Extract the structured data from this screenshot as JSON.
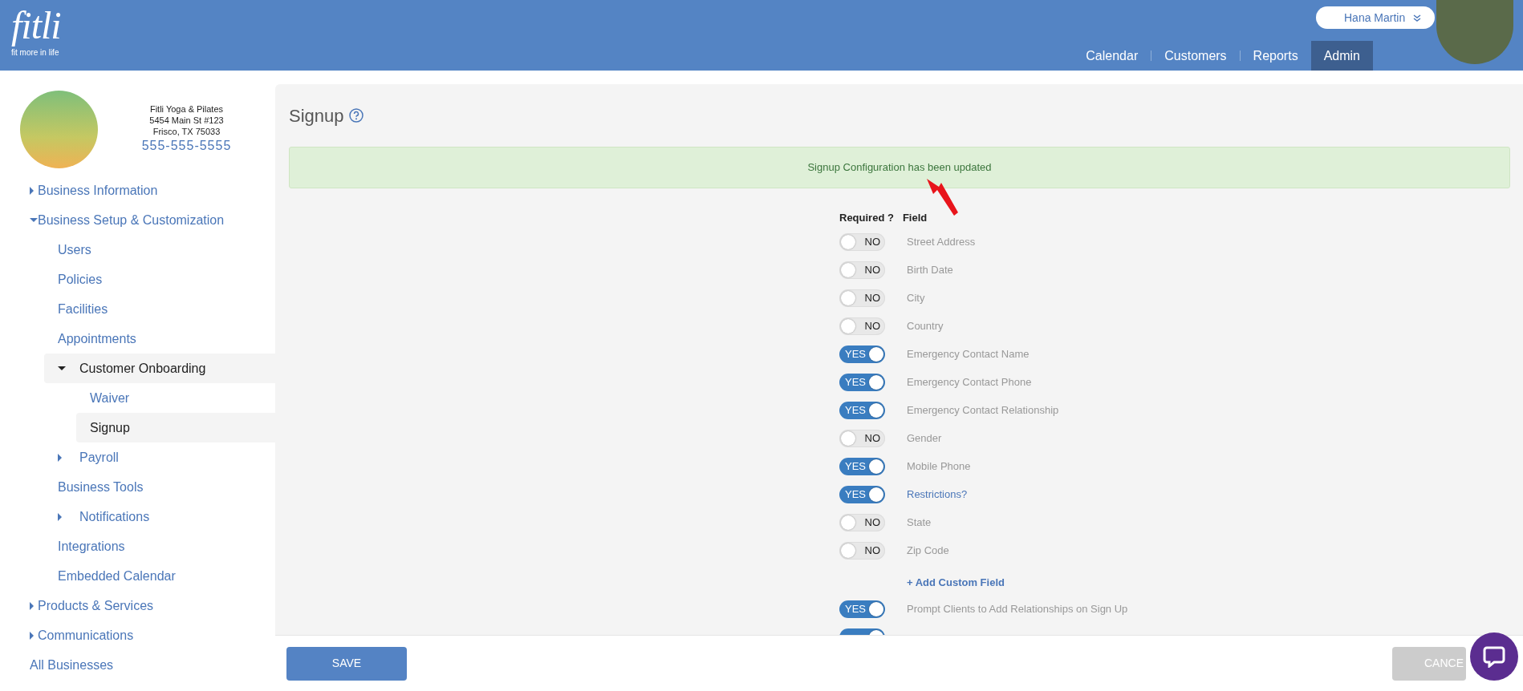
{
  "header": {
    "logo": {
      "wordmark": "fitli",
      "tagline": "fit more in life"
    },
    "user_menu": {
      "name": "Hana Martin"
    },
    "nav": [
      {
        "label": "Calendar",
        "selected": false
      },
      {
        "label": "Customers",
        "selected": false
      },
      {
        "label": "Reports",
        "selected": false
      },
      {
        "label": "Admin",
        "selected": true
      }
    ]
  },
  "business": {
    "name": "Fitli Yoga & Pilates",
    "address_line1": "5454 Main St #123",
    "address_line2": "Frisco, TX 75033",
    "phone": "555-555-5555"
  },
  "sidebar": {
    "items": [
      {
        "label": "Business Information",
        "expanded": false,
        "selected": false
      },
      {
        "label": "Business Setup & Customization",
        "expanded": true,
        "selected": false,
        "children": [
          {
            "label": "Users",
            "selected": false
          },
          {
            "label": "Policies",
            "selected": false
          },
          {
            "label": "Facilities",
            "selected": false
          },
          {
            "label": "Appointments",
            "selected": false
          },
          {
            "label": "Customer Onboarding",
            "expanded": true,
            "selected": true,
            "children": [
              {
                "label": "Waiver",
                "selected": false
              },
              {
                "label": "Signup",
                "selected": true
              }
            ]
          },
          {
            "label": "Payroll",
            "expanded": false,
            "selected": false
          },
          {
            "label": "Business Tools",
            "selected": false
          },
          {
            "label": "Notifications",
            "expanded": false,
            "selected": false
          },
          {
            "label": "Integrations",
            "selected": false
          },
          {
            "label": "Embedded Calendar",
            "selected": false
          }
        ]
      },
      {
        "label": "Products & Services",
        "expanded": false,
        "selected": false
      },
      {
        "label": "Communications",
        "expanded": false,
        "selected": false
      },
      {
        "label": "All Businesses",
        "selected": false
      }
    ]
  },
  "page": {
    "title": "Signup",
    "alert": "Signup Configuration has been updated",
    "columns": [
      "Required ?",
      "Field"
    ],
    "fields": [
      {
        "required": false,
        "toggle_text": "NO",
        "label": "Street Address",
        "kind": "text"
      },
      {
        "required": false,
        "toggle_text": "NO",
        "label": "Birth Date",
        "kind": "text"
      },
      {
        "required": false,
        "toggle_text": "NO",
        "label": "City",
        "kind": "text"
      },
      {
        "required": false,
        "toggle_text": "NO",
        "label": "Country",
        "kind": "text"
      },
      {
        "required": true,
        "toggle_text": "YES",
        "label": "Emergency Contact Name",
        "kind": "text"
      },
      {
        "required": true,
        "toggle_text": "YES",
        "label": "Emergency Contact Phone",
        "kind": "text"
      },
      {
        "required": true,
        "toggle_text": "YES",
        "label": "Emergency Contact Relationship",
        "kind": "text"
      },
      {
        "required": false,
        "toggle_text": "NO",
        "label": "Gender",
        "kind": "text"
      },
      {
        "required": true,
        "toggle_text": "YES",
        "label": "Mobile Phone",
        "kind": "text"
      },
      {
        "required": true,
        "toggle_text": "YES",
        "label": "Restrictions?",
        "kind": "link"
      },
      {
        "required": false,
        "toggle_text": "NO",
        "label": "State",
        "kind": "text"
      },
      {
        "required": false,
        "toggle_text": "NO",
        "label": "Zip Code",
        "kind": "text"
      }
    ],
    "add_link": "+ Add Custom Field",
    "extra_fields": [
      {
        "required": true,
        "toggle_text": "YES",
        "label": "Prompt Clients to Add Relationships on Sign Up",
        "kind": "text"
      },
      {
        "required": true
      }
    ]
  },
  "footer": {
    "save": "SAVE",
    "cancel": "CANCE"
  }
}
